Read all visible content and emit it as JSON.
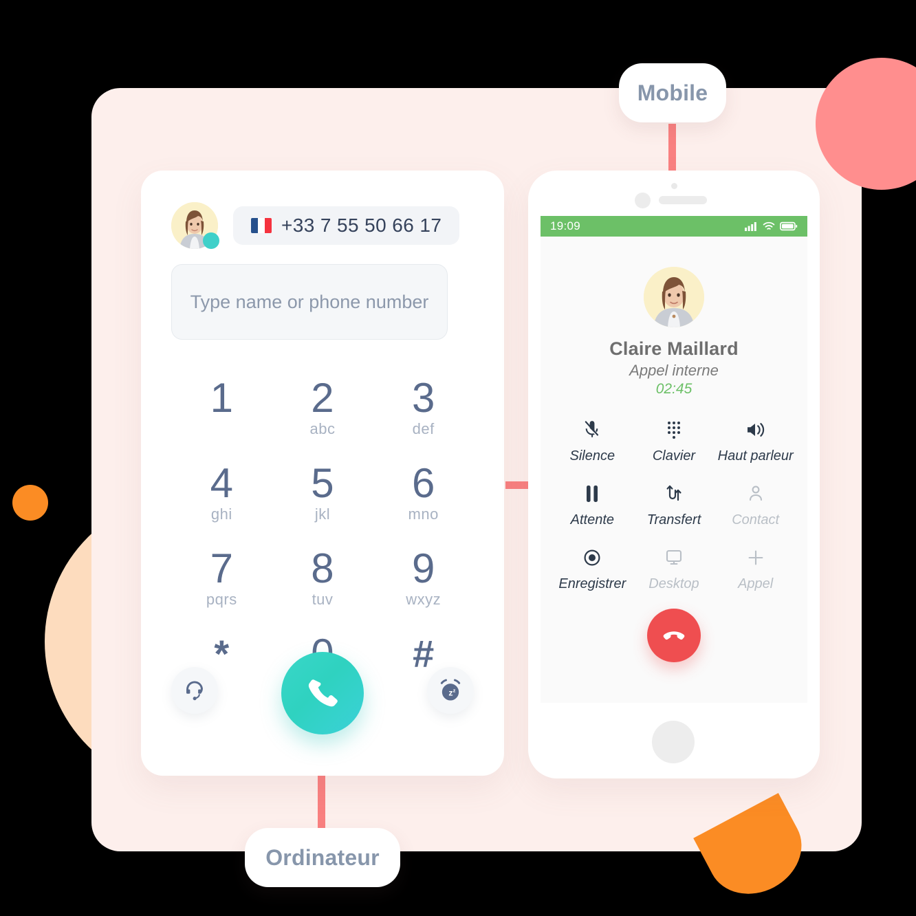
{
  "labels": {
    "mobile": "Mobile",
    "desktop": "Ordinateur"
  },
  "softphone": {
    "phone_number": "+33 7 55 50 66 17",
    "flag": "france-flag",
    "search_placeholder": "Type name or phone number",
    "search_value": "",
    "presence": "available",
    "keypad": [
      {
        "digit": "1",
        "letters": ""
      },
      {
        "digit": "2",
        "letters": "abc"
      },
      {
        "digit": "3",
        "letters": "def"
      },
      {
        "digit": "4",
        "letters": "ghi"
      },
      {
        "digit": "5",
        "letters": "jkl"
      },
      {
        "digit": "6",
        "letters": "mno"
      },
      {
        "digit": "7",
        "letters": "pqrs"
      },
      {
        "digit": "8",
        "letters": "tuv"
      },
      {
        "digit": "9",
        "letters": "wxyz"
      },
      {
        "digit": "*",
        "letters": ""
      },
      {
        "digit": "0",
        "letters": "+"
      },
      {
        "digit": "#",
        "letters": ""
      }
    ],
    "actions": {
      "headset": "headset-icon",
      "call": "phone-call-icon",
      "dnd": "snooze-alarm-icon"
    }
  },
  "mobile": {
    "status_bar": {
      "time": "19:09",
      "signal": "signal-bars-icon",
      "wifi": "wifi-icon",
      "battery": "battery-icon"
    },
    "call": {
      "contact_name": "Claire Maillard",
      "call_type": "Appel interne",
      "duration": "02:45"
    },
    "controls": [
      {
        "label": "Silence",
        "icon": "mic-muted-icon",
        "disabled": false
      },
      {
        "label": "Clavier",
        "icon": "dialpad-icon",
        "disabled": false
      },
      {
        "label": "Haut parleur",
        "icon": "speaker-icon",
        "disabled": false
      },
      {
        "label": "Attente",
        "icon": "pause-icon",
        "disabled": false
      },
      {
        "label": "Transfert",
        "icon": "transfer-icon",
        "disabled": false
      },
      {
        "label": "Contact",
        "icon": "person-icon",
        "disabled": true
      },
      {
        "label": "Enregistrer",
        "icon": "record-icon",
        "disabled": false
      },
      {
        "label": "Desktop",
        "icon": "monitor-icon",
        "disabled": true
      },
      {
        "label": "Appel",
        "icon": "plus-icon",
        "disabled": true
      }
    ],
    "hangup": "hangup-icon"
  },
  "colors": {
    "panel_bg": "#FDEFEC",
    "connector": "#F98080",
    "accent_teal": "#3FD0C9",
    "accent_green": "#6CC067",
    "accent_red": "#EF4E50",
    "accent_orange": "#FB8C24",
    "accent_peach": "#FDDCBE",
    "accent_pink": "#FF8E8E",
    "text_slate": "#5A6B8C"
  }
}
